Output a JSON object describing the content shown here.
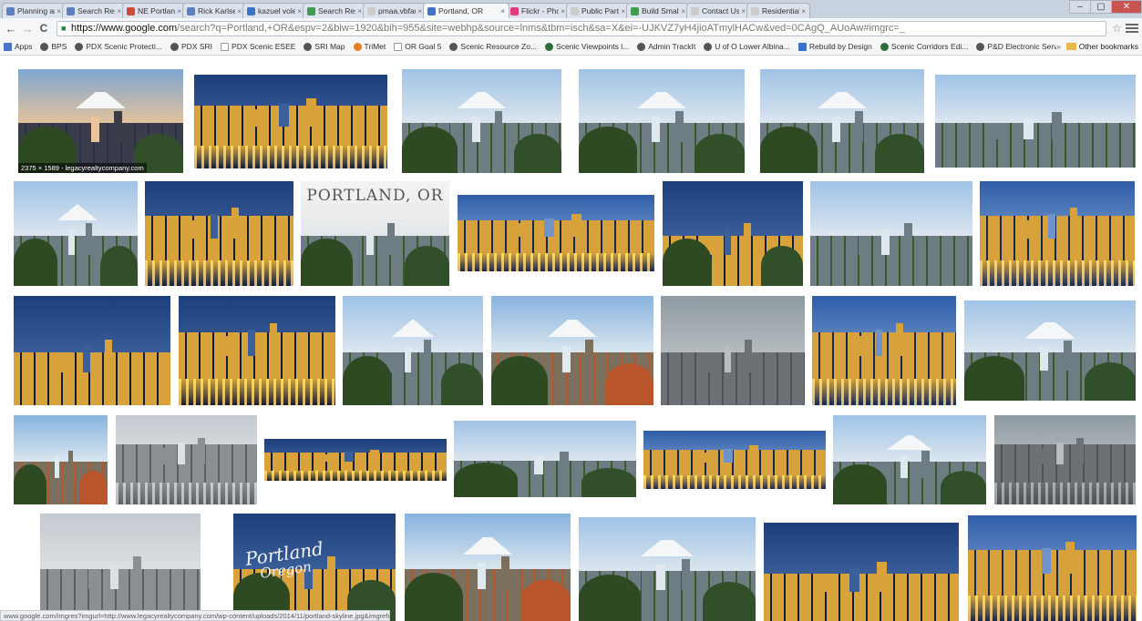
{
  "tabs": [
    {
      "title": "Planning and",
      "fav": "#5b7fbf"
    },
    {
      "title": "Search Result",
      "fav": "#5b7fbf"
    },
    {
      "title": "NE Portland",
      "fav": "#d04a3a"
    },
    {
      "title": "Rick Karlsen",
      "fav": "#5b7fbf"
    },
    {
      "title": "kazuel voleti",
      "fav": "#3b73c9"
    },
    {
      "title": "Search Result",
      "fav": "#3f9b4f"
    },
    {
      "title": "pmaa.vbfaux",
      "fav": "#cccccc"
    },
    {
      "title": "Portland, OR",
      "fav": "#3b73c9",
      "active": true
    },
    {
      "title": "Flickr - Photo",
      "fav": "#e3397b"
    },
    {
      "title": "Public Partne",
      "fav": "#cccccc"
    },
    {
      "title": "Build Smal, L",
      "fav": "#3f9b4f"
    },
    {
      "title": "Contact Us -",
      "fav": "#cccccc"
    },
    {
      "title": "Residential I",
      "fav": "#cccccc"
    }
  ],
  "toolbar": {
    "back": "←",
    "forward": "→",
    "reload": "C",
    "url_host": "https://www.google.com",
    "url_rest": "/search?q=Portland,+OR&espv=2&biw=1920&bih=955&site=webhp&source=lnms&tbm=isch&sa=X&ei=-UJKVZ7yH4jioATmylHACw&ved=0CAgQ_AUoAw#imgrc=_",
    "star": "☆"
  },
  "bookmarks": [
    {
      "label": "Apps",
      "icon": "apps-icon",
      "color": "#4a73c8"
    },
    {
      "label": "BPS",
      "icon": "globe-icon",
      "color": "#555555"
    },
    {
      "label": "PDX Scenic Protecti...",
      "icon": "globe-icon",
      "color": "#555555"
    },
    {
      "label": "PDX SRI",
      "icon": "globe-icon",
      "color": "#555555"
    },
    {
      "label": "PDX Scenic ESEE",
      "icon": "page-icon",
      "color": "#ffffff"
    },
    {
      "label": "SRI Map",
      "icon": "globe-icon",
      "color": "#555555"
    },
    {
      "label": "TriMet",
      "icon": "trimet-icon",
      "color": "#e77d1f"
    },
    {
      "label": "OR Goal 5",
      "icon": "page-icon",
      "color": "#ffffff"
    },
    {
      "label": "Scenic Resource Zo...",
      "icon": "globe-icon",
      "color": "#555555"
    },
    {
      "label": "Scenic Viewpoints l...",
      "icon": "globe-icon",
      "color": "#2f6e3a"
    },
    {
      "label": "Admin TrackIt",
      "icon": "globe-icon",
      "color": "#555555"
    },
    {
      "label": "U of O Lower Albina...",
      "icon": "globe-icon",
      "color": "#555555"
    },
    {
      "label": "Rebuild by Design",
      "icon": "flag-icon",
      "color": "#3b73c9"
    },
    {
      "label": "Scenic Corridors Edi...",
      "icon": "globe-icon",
      "color": "#2f6e3a"
    },
    {
      "label": "P&D Electronic Servi...",
      "icon": "globe-icon",
      "color": "#555555"
    }
  ],
  "other_bookmarks": "Other bookmarks",
  "thumb_overlay": "2375 × 1589 - legacyrealtycompany.com",
  "portland_caption": "PORTLAND, OR",
  "sign_text_1": "Portland",
  "sign_text_2": "Oregon",
  "status_text": "www.google.com/imgres?imgurl=http://www.legacyrealtycompany.com/wp-content/uploads/2014/11/portland-skyline.jpg&imgrefurl"
}
